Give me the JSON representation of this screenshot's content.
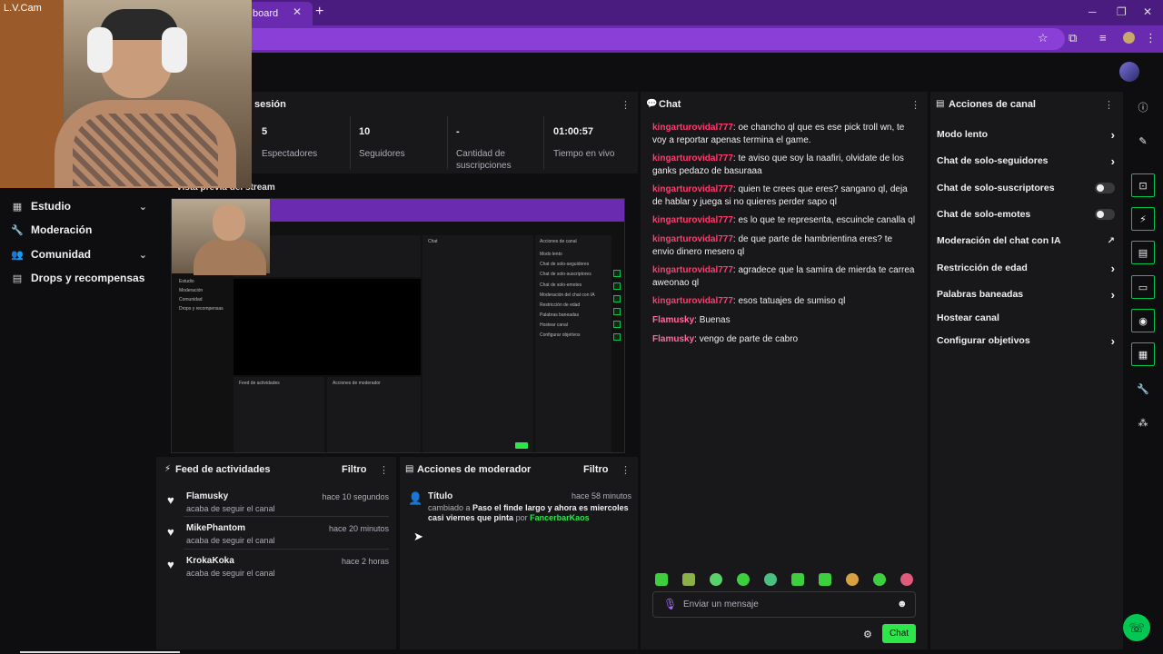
{
  "browser": {
    "tab_title": "board",
    "tab_close": "✕",
    "new_tab": "+",
    "win_min": "─",
    "win_max": "❐",
    "win_close": "✕"
  },
  "webcam": {
    "label": "L.V.Cam"
  },
  "sidebar": {
    "items": [
      {
        "label": "Estudio",
        "icon": "film-icon",
        "expandable": true
      },
      {
        "label": "Moderación",
        "icon": "wrench-icon",
        "expandable": false
      },
      {
        "label": "Comunidad",
        "icon": "users-icon",
        "expandable": true
      },
      {
        "label": "Drops y recompensas",
        "icon": "chart-icon",
        "expandable": false
      }
    ]
  },
  "session": {
    "title": "sesión",
    "stats": [
      {
        "value": "5",
        "label": "Espectadores"
      },
      {
        "value": "10",
        "label": "Seguidores"
      },
      {
        "value": "-",
        "label": "Cantidad de suscripciones"
      },
      {
        "value": "01:00:57",
        "label": "Tiempo en vivo"
      }
    ]
  },
  "preview": {
    "title": "Vista previa del stream"
  },
  "feed": {
    "title": "Feed de actividades",
    "filter_label": "Filtro",
    "items": [
      {
        "name": "Flamusky",
        "time": "hace 10 segundos",
        "sub": "acaba de seguir el canal"
      },
      {
        "name": "MikePhantom",
        "time": "hace 20 minutos",
        "sub": "acaba de seguir el canal"
      },
      {
        "name": "KrokaKoka",
        "time": "hace 2 horas",
        "sub": "acaba de seguir el canal"
      }
    ]
  },
  "mod_actions": {
    "title": "Acciones de moderador",
    "filter_label": "Filtro",
    "item": {
      "heading": "Título",
      "time": "hace 58 minutos",
      "changed": "cambiado a",
      "new_title": "Paso el finde largo y ahora es miercoles casi viernes que pinta",
      "by": "por",
      "moderator": "FancerbarKaos"
    }
  },
  "chat": {
    "title": "Chat",
    "messages": [
      {
        "user": "kingarturovidal777",
        "color": "#ff3c6e",
        "text": "oe chancho ql que es ese pick troll wn, te voy a reportar apenas termina el game."
      },
      {
        "user": "kingarturovidal777",
        "color": "#ff3c6e",
        "text": "te aviso que soy la naafiri, olvidate de los ganks pedazo de basuraaa"
      },
      {
        "user": "kingarturovidal777",
        "color": "#ff3c6e",
        "text": "quien te crees que eres? sangano ql, deja de hablar y juega si no quieres perder sapo ql"
      },
      {
        "user": "kingarturovidal777",
        "color": "#ff3c6e",
        "text": "es lo que te representa, escuincle canalla ql"
      },
      {
        "user": "kingarturovidal777",
        "color": "#ff3c6e",
        "text": "de que parte de hambrientina eres? te envio dinero mesero ql"
      },
      {
        "user": "kingarturovidal777",
        "color": "#ff3c6e",
        "text": "agradece que la samira de mierda te carrea aweonao ql"
      },
      {
        "user": "kingarturovidal777",
        "color": "#ff3c6e",
        "text": "esos tatuajes de sumiso ql"
      },
      {
        "user": "Flamusky",
        "color": "#ff6b9a",
        "text": "Buenas"
      },
      {
        "user": "Flamusky",
        "color": "#ff6b9a",
        "text": "vengo de parte de cabro"
      }
    ],
    "input_placeholder": "Enviar un mensaje",
    "send_label": "Chat"
  },
  "channel_actions": {
    "title": "Acciones de canal",
    "items": [
      {
        "label": "Modo lento",
        "control": "chevron"
      },
      {
        "label": "Chat de solo-seguidores",
        "control": "chevron"
      },
      {
        "label": "Chat de solo-suscriptores",
        "control": "toggle"
      },
      {
        "label": "Chat de solo-emotes",
        "control": "toggle"
      },
      {
        "label": "Moderación del chat con IA",
        "control": "external"
      },
      {
        "label": "Restricción de edad",
        "control": "chevron"
      },
      {
        "label": "Palabras baneadas",
        "control": "chevron"
      },
      {
        "label": "Hostear canal",
        "control": "none"
      },
      {
        "label": "Configurar objetivos",
        "control": "chevron"
      }
    ]
  },
  "colors": {
    "accent_purple": "#6a2bb0",
    "accent_green": "#2ce64a",
    "username_red": "#ff3c6e",
    "moderator_green": "#2ce64a"
  }
}
